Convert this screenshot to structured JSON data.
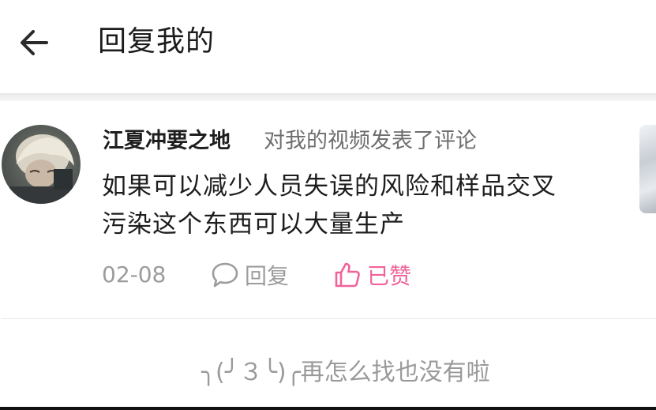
{
  "header": {
    "title": "回复我的",
    "back_icon": "arrow-left-icon"
  },
  "comment": {
    "username": "江夏冲要之地",
    "action": "对我的视频发表了评论",
    "content_line1": "如果可以减少人员失误的风险和样品交叉",
    "content_line2": "污染这个东西可以大量生产",
    "date": "02-08",
    "reply_label": "回复",
    "reply_icon": "speech-bubble-icon",
    "like_label": "已赞",
    "like_icon": "thumbs-up-icon",
    "like_color": "#f0639a"
  },
  "footer": {
    "end_text": "╮(╯３╰)╭再怎么找也没有啦"
  }
}
